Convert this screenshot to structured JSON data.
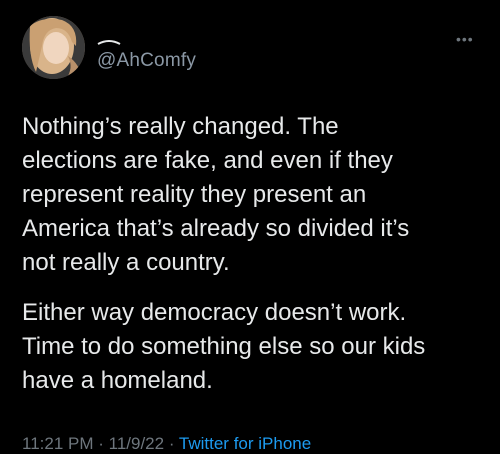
{
  "user": {
    "handle": "@AhComfy",
    "avatar_icon": "user-avatar-photo"
  },
  "tweet": {
    "paragraph_1": "Nothing’s really changed. The\nelections are fake, and even if they\nrepresent reality they present an\nAmerica that’s already so divided it’s\nnot really a country.",
    "paragraph_2": "Either way democracy doesn’t work.\nTime to do something else so our kids\nhave a homeland.",
    "time": "11:21 PM",
    "separator": " · ",
    "date": "11/9/22",
    "source": "Twitter for iPhone"
  },
  "icons": {
    "more": "more-options-icon"
  },
  "colors": {
    "background": "#000000",
    "text": "#e7e9ea",
    "secondary": "#8b98a5",
    "link": "#1d9bf0"
  }
}
